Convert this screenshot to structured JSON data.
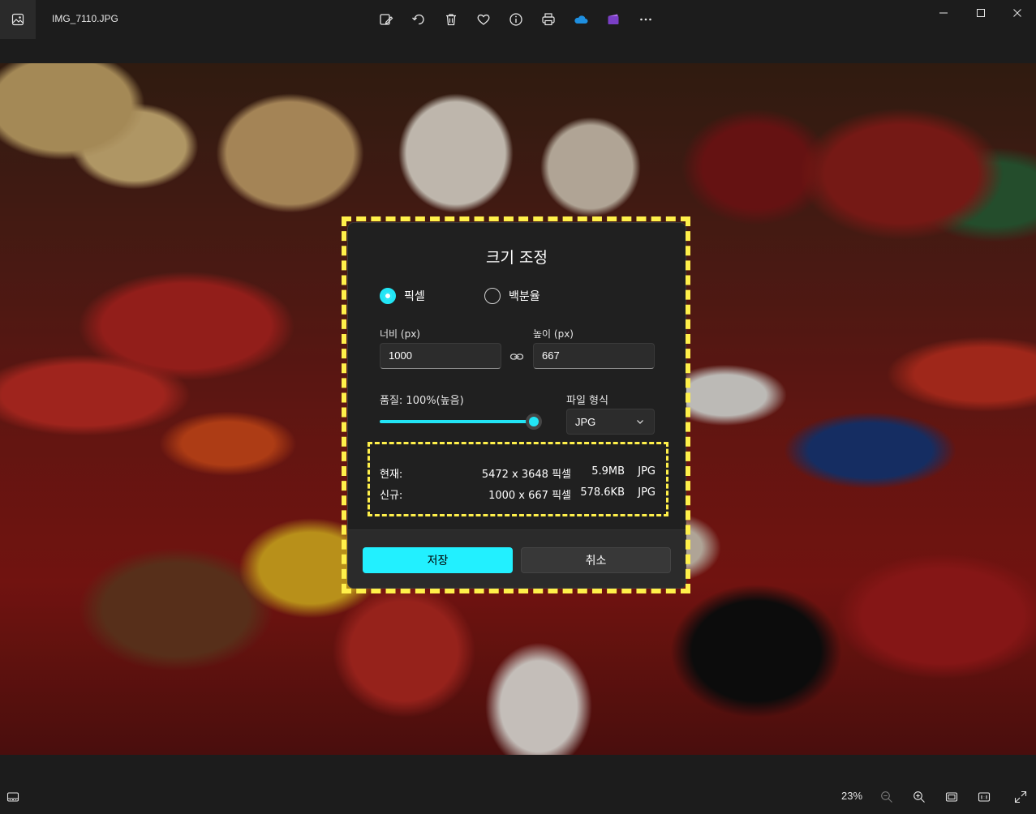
{
  "window": {
    "file_name": "IMG_7110.JPG",
    "toolbar_icons": [
      "edit-image-icon",
      "rotate-icon",
      "delete-icon",
      "favorite-icon",
      "info-icon",
      "print-icon",
      "onedrive-icon",
      "clipchamp-icon",
      "more-icon"
    ],
    "controls": [
      "minimize",
      "maximize",
      "close"
    ]
  },
  "dialog": {
    "title": "크기 조정",
    "radio_pixel": "픽셀",
    "radio_percent": "백분율",
    "width_label": "너비 (px)",
    "width_value": "1000",
    "height_label": "높이 (px)",
    "height_value": "667",
    "quality_label": "품질: 100%(높음)",
    "quality_value": 1.0,
    "format_label": "파일 형식",
    "format_value": "JPG",
    "current": {
      "label": "현재:",
      "dims": "5472 x 3648 픽셀",
      "size": "5.9MB",
      "format": "JPG"
    },
    "new": {
      "label": "신규:",
      "dims": "1000 x 667 픽셀",
      "size": "578.6KB",
      "format": "JPG"
    },
    "save_label": "저장",
    "cancel_label": "취소"
  },
  "statusbar": {
    "zoom": "23%"
  },
  "colors": {
    "accent": "#22e5f5",
    "highlight": "#fff04a",
    "dialog_bg": "#202020"
  }
}
